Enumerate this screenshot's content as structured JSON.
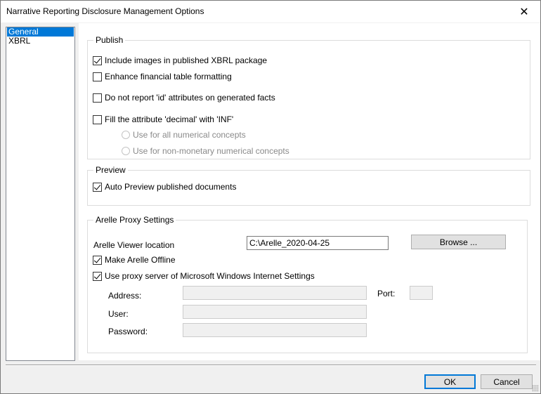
{
  "window": {
    "title": "Narrative Reporting Disclosure Management Options",
    "close_label": "✕"
  },
  "nav": {
    "items": [
      "General",
      "XBRL"
    ],
    "selected": "General"
  },
  "publish": {
    "legend": "Publish",
    "include_images": {
      "label": "Include images in published XBRL package",
      "checked": true
    },
    "enhance_tables": {
      "label": "Enhance financial table formatting",
      "checked": false
    },
    "no_id_attributes": {
      "label": "Do not report 'id' attributes on generated facts",
      "checked": false
    },
    "fill_decimal": {
      "label": "Fill the attribute 'decimal' with 'INF'",
      "checked": false
    },
    "radio_all": {
      "label": "Use for all numerical concepts",
      "enabled": false
    },
    "radio_non_monetary": {
      "label": "Use for non-monetary numerical concepts",
      "enabled": false
    }
  },
  "preview": {
    "legend": "Preview",
    "auto_preview": {
      "label": "Auto Preview published documents",
      "checked": true
    }
  },
  "arelle": {
    "legend": "Arelle Proxy Settings",
    "viewer_location_label": "Arelle Viewer location",
    "viewer_location_value": "C:\\Arelle_2020-04-25",
    "browse_label": "Browse ...",
    "make_offline": {
      "label": "Make Arelle Offline",
      "checked": true
    },
    "use_proxy": {
      "label": "Use proxy server of Microsoft Windows Internet Settings",
      "checked": true
    },
    "address_label": "Address:",
    "port_label": "Port:",
    "user_label": "User:",
    "password_label": "Password:",
    "address_value": "",
    "port_value": "",
    "user_value": "",
    "password_value": ""
  },
  "footer": {
    "ok_label": "OK",
    "cancel_label": "Cancel"
  },
  "colors": {
    "selection": "#0078d7",
    "dialog_bg": "#f0f0f0",
    "disabled_text": "#8a8a8a"
  }
}
